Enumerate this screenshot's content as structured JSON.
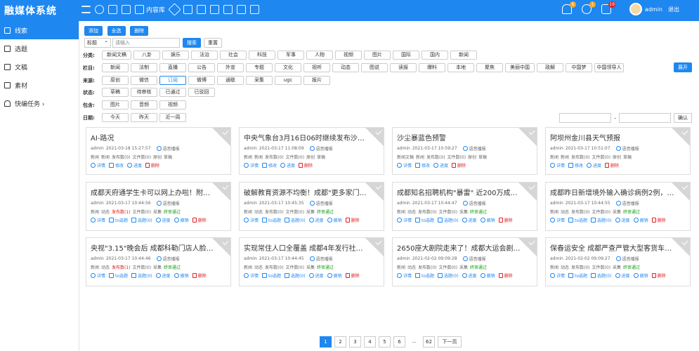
{
  "app": {
    "title": "融媒体系统"
  },
  "topbar": {
    "library_label": "内容库",
    "user": "admin",
    "logout": "退出",
    "badges": {
      "bell": "6",
      "chat": "1",
      "calendar": "19"
    }
  },
  "sidebar": {
    "items": [
      {
        "label": "线索",
        "icon": "list-icon"
      },
      {
        "label": "选题",
        "icon": "book-icon"
      },
      {
        "label": "文稿",
        "icon": "document-icon"
      },
      {
        "label": "素材",
        "icon": "folder-icon"
      },
      {
        "label": "快编任务 ›",
        "icon": "bell-icon"
      }
    ]
  },
  "toolbar": {
    "add": "添加",
    "select_all": "全选",
    "delete": "删除"
  },
  "search": {
    "field": "标题",
    "placeholder": "请输入",
    "search_btn": "搜索",
    "reset_btn": "重置"
  },
  "filters": {
    "category": {
      "label": "分类:",
      "options": [
        "新闻文稿",
        "八卦",
        "娱乐",
        "法治",
        "社会",
        "科技",
        "军事",
        "人物",
        "视频",
        "图片",
        "国际",
        "国内",
        "新闻"
      ]
    },
    "column": {
      "label": "栏目:",
      "options": [
        "新闻",
        "法制",
        "直播",
        "公告",
        "外宣",
        "专题",
        "文化",
        "视听",
        "动态",
        "图说",
        "读报",
        "爆料",
        "本地",
        "聚焦",
        "美丽中国",
        "政解",
        "中国梦",
        "中国领导人"
      ],
      "expand": "展开"
    },
    "source": {
      "label": "来源:",
      "options": [
        "原创",
        "微信",
        "订阅",
        "微博",
        "通联",
        "采集",
        "ugc",
        "报片"
      ],
      "selected": "订阅"
    },
    "status": {
      "label": "状态:",
      "options": [
        "草稿",
        "待审核",
        "已通过",
        "已驳回"
      ]
    },
    "contains": {
      "label": "包含:",
      "options": [
        "图片",
        "音频",
        "视频"
      ]
    },
    "date": {
      "label": "日期:",
      "options": [
        "今天",
        "昨天",
        "近一周"
      ],
      "separator": "-",
      "confirm": "确认"
    }
  },
  "actions_simple": {
    "detail": "详情",
    "edit": "修改",
    "progress": "进度",
    "delete": "删除"
  },
  "actions_full": {
    "detail": "详情",
    "to_topic": "to选题",
    "topic": "选题(0)",
    "progress": "进度",
    "withdraw": "撤销",
    "delete": "删除"
  },
  "cards": [
    {
      "title": "AI-路况",
      "author": "admin",
      "time": "2021-03-18 15:27:57",
      "source": "语音播报",
      "cat": "新闻",
      "col": "新闻",
      "pub": "发布数(0)",
      "docs": "文件数(0)",
      "orig": "原创",
      "status": "草稿"
    },
    {
      "title": "中央气象台3月16日06时继续发布沙尘暴...",
      "author": "admin",
      "time": "2021-03-17 11:08:09",
      "source": "语音播报",
      "cat": "新闻",
      "col": "新闻",
      "pub": "发布数(0)",
      "docs": "文件数(0)",
      "orig": "原创",
      "status": "草稿"
    },
    {
      "title": "沙尘暴蓝色预警",
      "author": "admin",
      "time": "2021-03-17 10:59:27",
      "source": "语音播报",
      "cat": "新闻文稿",
      "col": "新闻",
      "pub": "发布数(0)",
      "docs": "文件数(0)",
      "orig": "原创",
      "status": "草稿"
    },
    {
      "title": "阿坝州金川县天气预报",
      "author": "admin",
      "time": "2021-03-17 10:51:07",
      "source": "语音播报",
      "cat": "新闻",
      "col": "新闻",
      "pub": "发布数(0)",
      "docs": "文件数(0)",
      "orig": "原创",
      "status": "草稿"
    },
    {
      "title": "成都天府通学生卡可以网上办啦！附攻略",
      "author": "admin",
      "time": "2021-03-17 10:44:56",
      "source": "语音播报",
      "cat": "新闻",
      "col": "动态",
      "pub": "发布数(1)",
      "docs": "文件数(0)",
      "orig": "采集",
      "status": "终审通过"
    },
    {
      "title": "破解教育资源不均衡！成都\"更多家门口...",
      "author": "admin",
      "time": "2021-03-17 10:45:35",
      "source": "语音播报",
      "cat": "新闻",
      "col": "动态",
      "pub": "发布数(0)",
      "docs": "文件数(0)",
      "orig": "采集",
      "status": "终审通过"
    },
    {
      "title": "成都知名招聘机构\"暴雷\" 近200万成人教...",
      "author": "admin",
      "time": "2021-03-17 10:44:47",
      "source": "语音播报",
      "cat": "新闻",
      "col": "动态",
      "pub": "发布数(0)",
      "docs": "文件数(0)",
      "orig": "采集",
      "status": "终审通过"
    },
    {
      "title": "成都昨日新增境外输入确诊病例2例，详...",
      "author": "admin",
      "time": "2021-03-17 10:44:55",
      "source": "语音播报",
      "cat": "新闻",
      "col": "动态",
      "pub": "发布数(0)",
      "docs": "文件数(0)",
      "orig": "采集",
      "status": "终审通过"
    },
    {
      "title": "央视\"3.15\"晚会后 成都科勒门店人脸识别...",
      "author": "admin",
      "time": "2021-03-17 10:44:46",
      "source": "语音播报",
      "cat": "新闻",
      "col": "动态",
      "pub": "发布数(1)",
      "docs": "文件数(0)",
      "orig": "采集",
      "status": "终审通过"
    },
    {
      "title": "实现常住人口全覆盖 成都4年发行社会保...",
      "author": "admin",
      "time": "2021-03-17 10:44:45",
      "source": "语音播报",
      "cat": "新闻",
      "col": "动态",
      "pub": "发布数(0)",
      "docs": "文件数(0)",
      "orig": "采集",
      "status": "终审通过"
    },
    {
      "title": "2650座大剧院走来了！成都大运会剧院...",
      "author": "admin",
      "time": "2021-02-02 09:09:28",
      "source": "语音播报",
      "cat": "新闻",
      "col": "动态",
      "pub": "发布数(0)",
      "docs": "文件数(0)",
      "orig": "采集",
      "status": "终审通过"
    },
    {
      "title": "保春运安全 成都严查严管大型客货车运...",
      "author": "admin",
      "time": "2021-02-02 09:09:27",
      "source": "语音播报",
      "cat": "新闻",
      "col": "动态",
      "pub": "发布数(0)",
      "docs": "文件数(0)",
      "orig": "采集",
      "status": "终审通过"
    }
  ],
  "pagination": {
    "pages": [
      "1",
      "2",
      "3",
      "4",
      "5",
      "6",
      "...",
      "62"
    ],
    "current": "1",
    "next": "下一页"
  },
  "colors": {
    "primary": "#1e87f0",
    "danger": "#e02020",
    "success": "#12a012"
  }
}
